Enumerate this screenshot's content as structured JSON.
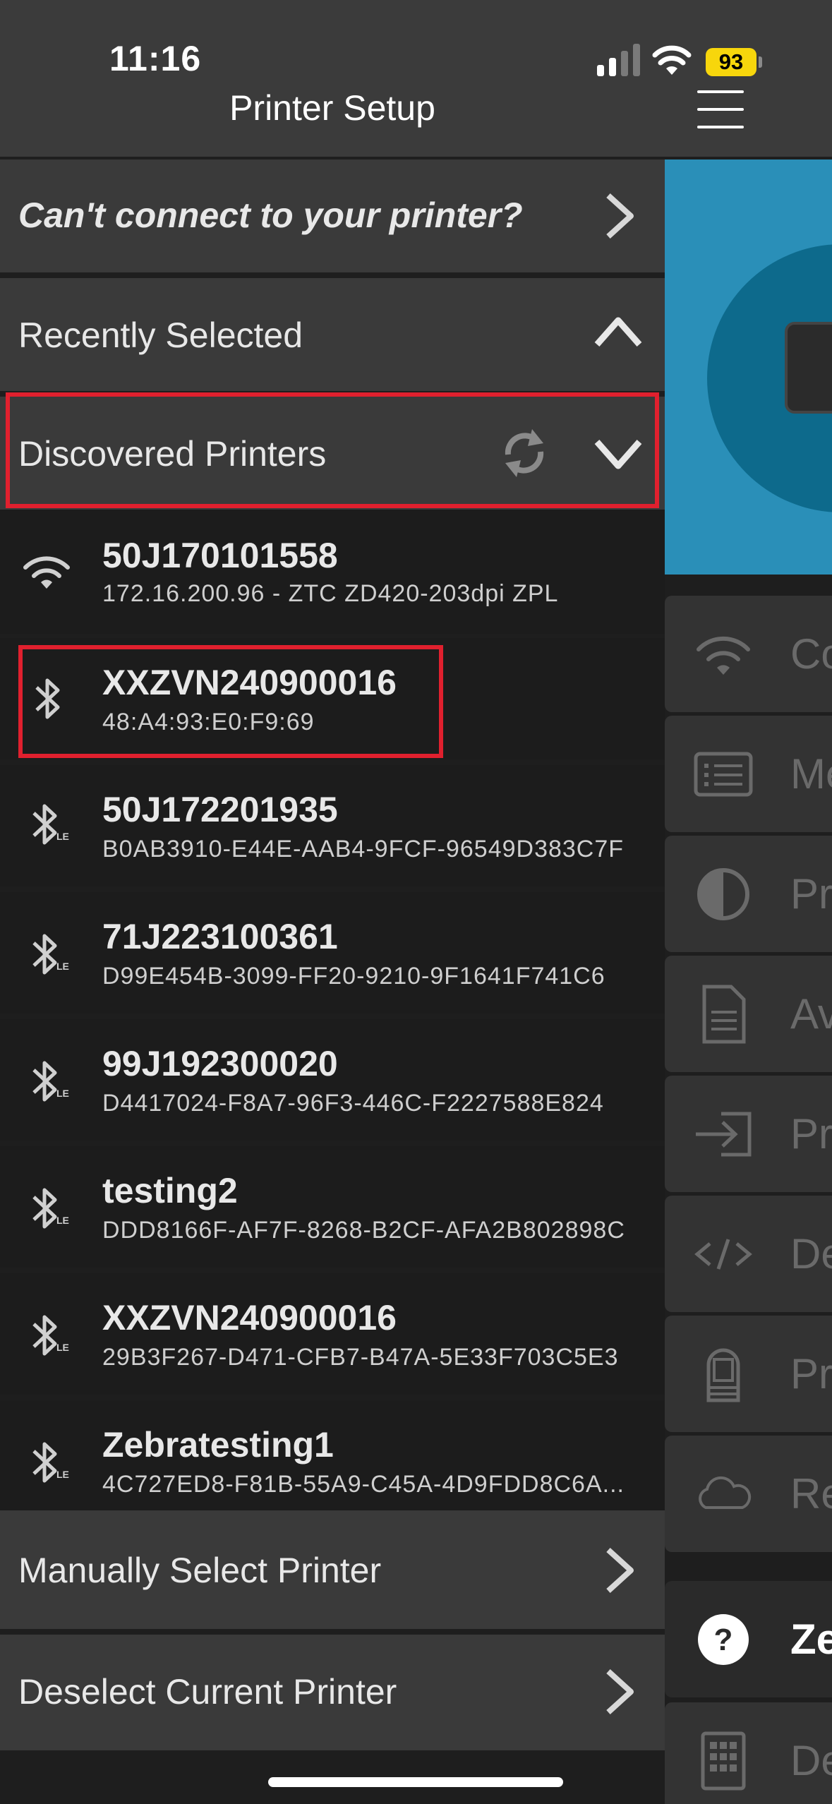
{
  "status_bar": {
    "time": "11:16",
    "battery": "93"
  },
  "header": {
    "title": "Printer Setup"
  },
  "drawer": {
    "help_row": {
      "label": "Can't connect to your printer?"
    },
    "recently_selected": {
      "label": "Recently Selected"
    },
    "discovered": {
      "label": "Discovered Printers"
    },
    "printers": [
      {
        "type": "wifi",
        "name": "50J170101558",
        "detail": "172.16.200.96 - ZTC ZD420-203dpi ZPL"
      },
      {
        "type": "bluetooth",
        "name": "XXZVN240900016",
        "detail": "48:A4:93:E0:F9:69"
      },
      {
        "type": "bluetooth-le",
        "name": "50J172201935",
        "detail": "B0AB3910-E44E-AAB4-9FCF-96549D383C7F"
      },
      {
        "type": "bluetooth-le",
        "name": "71J223100361",
        "detail": "D99E454B-3099-FF20-9210-9F1641F741C6"
      },
      {
        "type": "bluetooth-le",
        "name": "99J192300020",
        "detail": "D4417024-F8A7-96F3-446C-F2227588E824"
      },
      {
        "type": "bluetooth-le",
        "name": "testing2",
        "detail": "DDD8166F-AF7F-8268-B2CF-AFA2B802898C"
      },
      {
        "type": "bluetooth-le",
        "name": "XXZVN240900016",
        "detail": "29B3F267-D471-CFB7-B47A-5E33F703C5E3"
      },
      {
        "type": "bluetooth-le",
        "name": "Zebratesting1",
        "detail": "4C727ED8-F81B-55A9-C45A-4D9FDD8C6A..."
      }
    ],
    "manual_select": {
      "label": "Manually Select Printer"
    },
    "deselect": {
      "label": "Deselect Current Printer"
    }
  },
  "background_menu": {
    "items": [
      {
        "icon": "wifi-icon",
        "label": "Co"
      },
      {
        "icon": "list-icon",
        "label": "Me"
      },
      {
        "icon": "contrast-icon",
        "label": "Pr"
      },
      {
        "icon": "document-icon",
        "label": "Av"
      },
      {
        "icon": "import-icon",
        "label": "Pr"
      },
      {
        "icon": "code-icon",
        "label": "De"
      },
      {
        "icon": "printer-icon",
        "label": "Pr"
      },
      {
        "icon": "cloud-icon",
        "label": "Re"
      },
      {
        "icon": "help-circle-icon",
        "label": "Ze"
      },
      {
        "icon": "keypad-icon",
        "label": "De"
      }
    ]
  },
  "colors": {
    "highlight": "#e0202e",
    "battery": "#f7d60c",
    "hero": "#2a8fb8"
  }
}
